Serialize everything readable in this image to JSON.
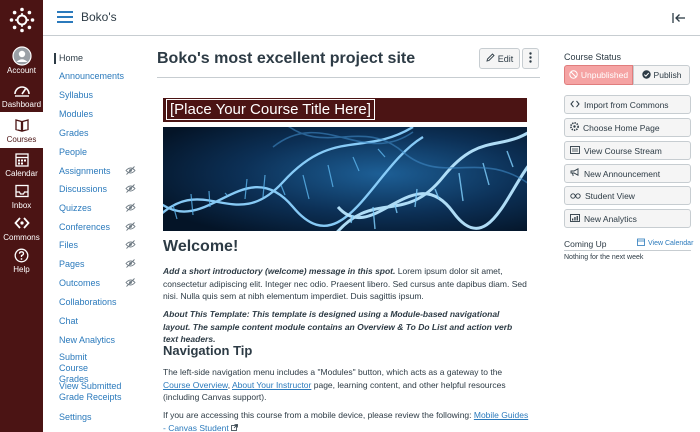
{
  "global_nav": {
    "items": [
      {
        "label": "Account",
        "icon": "avatar-icon"
      },
      {
        "label": "Dashboard",
        "icon": "dashboard-icon"
      },
      {
        "label": "Courses",
        "icon": "book-icon"
      },
      {
        "label": "Calendar",
        "icon": "calendar-icon"
      },
      {
        "label": "Inbox",
        "icon": "inbox-icon"
      },
      {
        "label": "Commons",
        "icon": "commons-icon"
      },
      {
        "label": "Help",
        "icon": "help-icon"
      }
    ],
    "active": "Courses",
    "colors": {
      "background": "#4b1414",
      "active_bg": "#ffffff"
    }
  },
  "header": {
    "breadcrumb": "Boko's"
  },
  "course_nav": {
    "items": [
      {
        "label": "Home",
        "active": true,
        "hidden": false
      },
      {
        "label": "Announcements",
        "hidden": false
      },
      {
        "label": "Syllabus",
        "hidden": false
      },
      {
        "label": "Modules",
        "hidden": false
      },
      {
        "label": "Grades",
        "hidden": false
      },
      {
        "label": "People",
        "hidden": false
      },
      {
        "label": "Assignments",
        "hidden": true
      },
      {
        "label": "Discussions",
        "hidden": true
      },
      {
        "label": "Quizzes",
        "hidden": true
      },
      {
        "label": "Conferences",
        "hidden": true
      },
      {
        "label": "Files",
        "hidden": true
      },
      {
        "label": "Pages",
        "hidden": true
      },
      {
        "label": "Outcomes",
        "hidden": true
      },
      {
        "label": "Collaborations",
        "hidden": false
      },
      {
        "label": "Chat",
        "hidden": false
      },
      {
        "label": "New Analytics",
        "hidden": false
      },
      {
        "label": "Submit Course Grades",
        "hidden": false
      },
      {
        "label": "View Submitted Grade Receipts",
        "hidden": false
      },
      {
        "label": "Settings",
        "hidden": false
      }
    ]
  },
  "main": {
    "title": "Boko's most excellent project site",
    "edit_label": "Edit",
    "banner": "[Place Your Course Title Here]",
    "welcome_heading": "Welcome!",
    "intro_italic": "Add a short introductory (welcome) message in this spot.",
    "intro_rest": " Lorem ipsum dolor sit amet, consectetur adipiscing elit. Integer nec odio. Praesent libero. Sed cursus ante dapibus diam. Sed nisi. Nulla quis sem at nibh elementum imperdiet. Duis sagittis ipsum.",
    "about": "About This Template: This template is designed using a Module-based navigational layout. The sample content module contains an Overview & To Do List and action verb text headers.",
    "nav_heading": "Navigation Tip",
    "nav_p1_a": "The left-side navigation menu includes a \"Modules\" button, which acts as a gateway to the ",
    "nav_p1_link1": "Course Overview",
    "nav_p1_b": ", ",
    "nav_p1_link2": "About Your Instructor",
    "nav_p1_c": " page, learning content, and other helpful resources (including Canvas support).",
    "nav_p2_a": "If you are accessing this course from a mobile device, please review the following: ",
    "nav_p2_link": "Mobile Guides - Canvas Student"
  },
  "sidebar": {
    "status_title": "Course Status",
    "unpublished_label": "Unpublished",
    "publish_label": "Publish",
    "buttons": [
      {
        "label": "Import from Commons",
        "icon": "commons-icon"
      },
      {
        "label": "Choose Home Page",
        "icon": "gear-icon"
      },
      {
        "label": "View Course Stream",
        "icon": "stream-icon"
      },
      {
        "label": "New Announcement",
        "icon": "megaphone-icon"
      },
      {
        "label": "Student View",
        "icon": "glasses-icon"
      },
      {
        "label": "New Analytics",
        "icon": "analytics-icon"
      }
    ],
    "coming_up": "Coming Up",
    "view_calendar": "View Calendar",
    "nothing": "Nothing for the next week"
  }
}
